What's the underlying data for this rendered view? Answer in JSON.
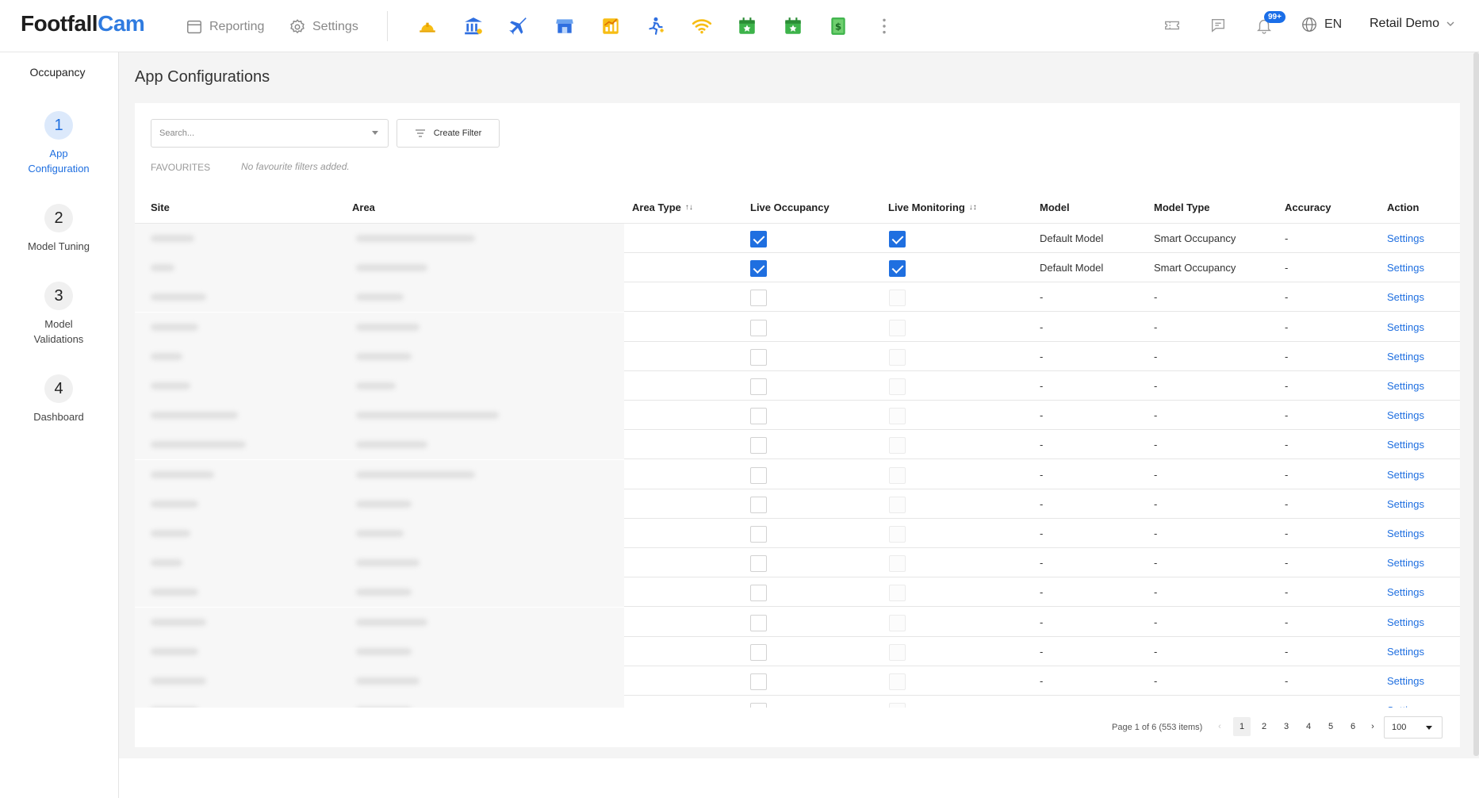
{
  "header": {
    "logo_part1": "Footfall",
    "logo_part2": "Cam",
    "nav_reporting": "Reporting",
    "nav_settings": "Settings",
    "app_icons": [
      "hardhat-icon",
      "bank-icon",
      "airplane-icon",
      "store-icon",
      "chart-icon",
      "person-run-icon",
      "wifi-icon",
      "calendar-star-icon",
      "calendar-star-alt-icon",
      "money-bill-icon"
    ],
    "notification_badge": "99+",
    "language": "EN",
    "user_name": "Retail Demo"
  },
  "sidebar": {
    "title": "Occupancy",
    "steps": [
      {
        "num": "1",
        "label": "App Configuration",
        "active": true
      },
      {
        "num": "2",
        "label": "Model Tuning",
        "active": false
      },
      {
        "num": "3",
        "label": "Model Validations",
        "active": false
      },
      {
        "num": "4",
        "label": "Dashboard",
        "active": false
      }
    ]
  },
  "page": {
    "title": "App Configurations",
    "search_placeholder": "Search...",
    "create_filter_label": "Create Filter",
    "favourites_label": "FAVOURITES",
    "favourites_empty": "No favourite filters added."
  },
  "table": {
    "columns": [
      "Site",
      "Area",
      "Area Type",
      "Live Occupancy",
      "Live Monitoring",
      "Model",
      "Model Type",
      "Accuracy",
      "Action"
    ],
    "rows": [
      {
        "live_occupancy": true,
        "live_monitoring": true,
        "model": "Default Model",
        "model_type": "Smart Occupancy",
        "accuracy": "-",
        "action": "Settings"
      },
      {
        "live_occupancy": true,
        "live_monitoring": true,
        "model": "Default Model",
        "model_type": "Smart Occupancy",
        "accuracy": "-",
        "action": "Settings"
      },
      {
        "live_occupancy": false,
        "live_monitoring": false,
        "model": "-",
        "model_type": "-",
        "accuracy": "-",
        "action": "Settings"
      },
      {
        "live_occupancy": false,
        "live_monitoring": false,
        "model": "-",
        "model_type": "-",
        "accuracy": "-",
        "action": "Settings"
      },
      {
        "live_occupancy": false,
        "live_monitoring": false,
        "model": "-",
        "model_type": "-",
        "accuracy": "-",
        "action": "Settings"
      },
      {
        "live_occupancy": false,
        "live_monitoring": false,
        "model": "-",
        "model_type": "-",
        "accuracy": "-",
        "action": "Settings"
      },
      {
        "live_occupancy": false,
        "live_monitoring": false,
        "model": "-",
        "model_type": "-",
        "accuracy": "-",
        "action": "Settings"
      },
      {
        "live_occupancy": false,
        "live_monitoring": false,
        "model": "-",
        "model_type": "-",
        "accuracy": "-",
        "action": "Settings"
      },
      {
        "live_occupancy": false,
        "live_monitoring": false,
        "model": "-",
        "model_type": "-",
        "accuracy": "-",
        "action": "Settings"
      },
      {
        "live_occupancy": false,
        "live_monitoring": false,
        "model": "-",
        "model_type": "-",
        "accuracy": "-",
        "action": "Settings"
      },
      {
        "live_occupancy": false,
        "live_monitoring": false,
        "model": "-",
        "model_type": "-",
        "accuracy": "-",
        "action": "Settings"
      },
      {
        "live_occupancy": false,
        "live_monitoring": false,
        "model": "-",
        "model_type": "-",
        "accuracy": "-",
        "action": "Settings"
      },
      {
        "live_occupancy": false,
        "live_monitoring": false,
        "model": "-",
        "model_type": "-",
        "accuracy": "-",
        "action": "Settings"
      },
      {
        "live_occupancy": false,
        "live_monitoring": false,
        "model": "-",
        "model_type": "-",
        "accuracy": "-",
        "action": "Settings"
      },
      {
        "live_occupancy": false,
        "live_monitoring": false,
        "model": "-",
        "model_type": "-",
        "accuracy": "-",
        "action": "Settings"
      },
      {
        "live_occupancy": false,
        "live_monitoring": false,
        "model": "-",
        "model_type": "-",
        "accuracy": "-",
        "action": "Settings"
      },
      {
        "live_occupancy": false,
        "live_monitoring": false,
        "model": "",
        "model_type": "",
        "accuracy": "",
        "action": "Settings"
      }
    ]
  },
  "pagination": {
    "info": "Page 1 of 6 (553 items)",
    "pages": [
      "1",
      "2",
      "3",
      "4",
      "5",
      "6"
    ],
    "current": "1",
    "prev": "‹",
    "next": "›",
    "per_page": "100"
  },
  "colors": {
    "accent": "#1f6fe0",
    "brand_dark": "#1e1e1e",
    "brand_blue": "#2f7be0"
  }
}
